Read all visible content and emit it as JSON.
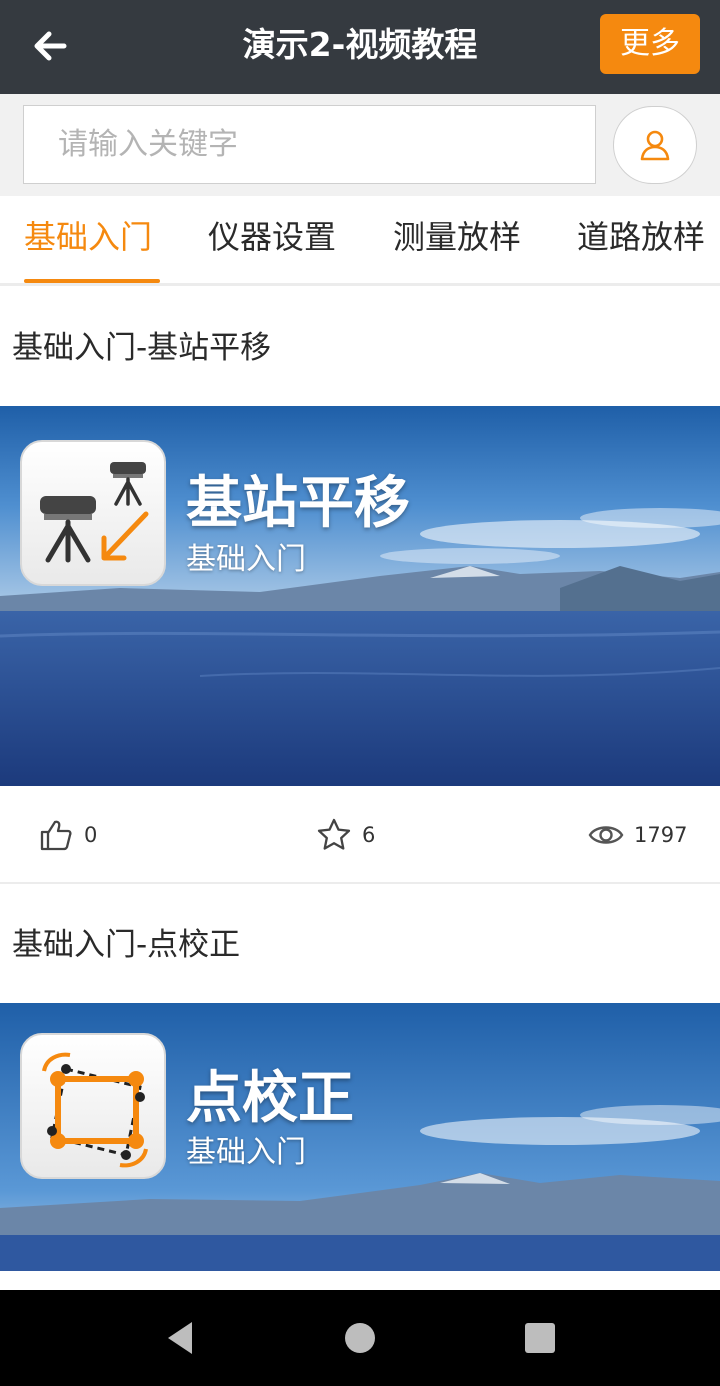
{
  "header": {
    "title": "演示2-视频教程",
    "more_label": "更多"
  },
  "search": {
    "placeholder": "请输入关键字",
    "value": ""
  },
  "tabs": [
    {
      "label": "基础入门",
      "active": true
    },
    {
      "label": "仪器设置",
      "active": false
    },
    {
      "label": "测量放样",
      "active": false
    },
    {
      "label": "道路放样",
      "active": false
    }
  ],
  "videos": [
    {
      "title": "基础入门-基站平移",
      "thumb_title": "基站平移",
      "thumb_subtitle": "基础入门",
      "icon": "base-station-shift-icon",
      "likes": "0",
      "favorites": "6",
      "views": "1797"
    },
    {
      "title": "基础入门-点校正",
      "thumb_title": "点校正",
      "thumb_subtitle": "基础入门",
      "icon": "point-calibration-icon"
    }
  ],
  "colors": {
    "accent": "#f5890f",
    "header_bg": "#353a40",
    "tab_active": "#f5890f"
  }
}
